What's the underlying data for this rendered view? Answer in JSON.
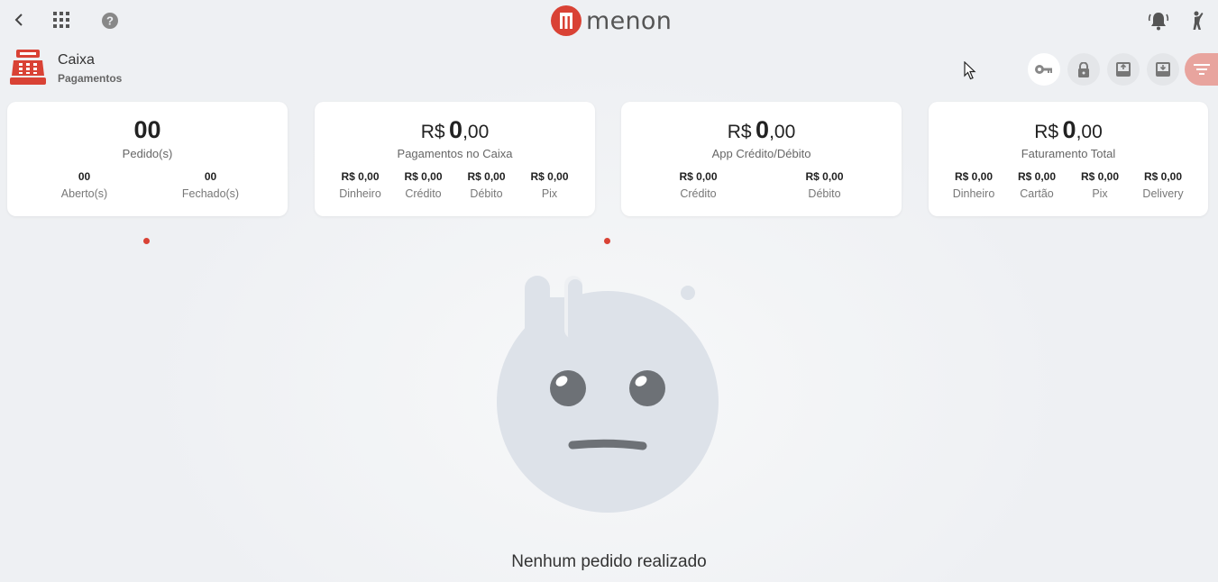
{
  "brand": {
    "name": "menon",
    "color": "#d94235"
  },
  "topbar": {
    "icons": [
      "back-icon",
      "apps-icon",
      "help-icon",
      "notification-bell-icon",
      "person-icon"
    ]
  },
  "section": {
    "title": "Caixa",
    "subtitle": "Pagamentos",
    "icon": "cash-register-icon"
  },
  "actions": [
    "key-icon",
    "lock-icon",
    "download-box-icon",
    "upload-box-icon",
    "filter-icon"
  ],
  "cards": [
    {
      "value": "00",
      "label": "Pedido(s)",
      "subs": [
        {
          "value": "00",
          "label": "Aberto(s)"
        },
        {
          "value": "00",
          "label": "Fechado(s)"
        }
      ]
    },
    {
      "prefix": "R$",
      "int": "0",
      "dec": ",00",
      "label": "Pagamentos no Caixa",
      "subs": [
        {
          "value": "R$ 0,00",
          "label": "Dinheiro"
        },
        {
          "value": "R$ 0,00",
          "label": "Crédito"
        },
        {
          "value": "R$ 0,00",
          "label": "Débito"
        },
        {
          "value": "R$ 0,00",
          "label": "Pix"
        }
      ]
    },
    {
      "prefix": "R$",
      "int": "0",
      "dec": ",00",
      "label": "App Crédito/Débito",
      "subs": [
        {
          "value": "R$ 0,00",
          "label": "Crédito"
        },
        {
          "value": "R$ 0,00",
          "label": "Débito"
        }
      ]
    },
    {
      "prefix": "R$",
      "int": "0",
      "dec": ",00",
      "label": "Faturamento Total",
      "subs": [
        {
          "value": "R$ 0,00",
          "label": "Dinheiro"
        },
        {
          "value": "R$ 0,00",
          "label": "Cartão"
        },
        {
          "value": "R$ 0,00",
          "label": "Pix"
        },
        {
          "value": "R$ 0,00",
          "label": "Delivery"
        }
      ]
    }
  ],
  "empty_state": {
    "message": "Nenhum pedido realizado",
    "illustration": "sad-face-illustration"
  }
}
